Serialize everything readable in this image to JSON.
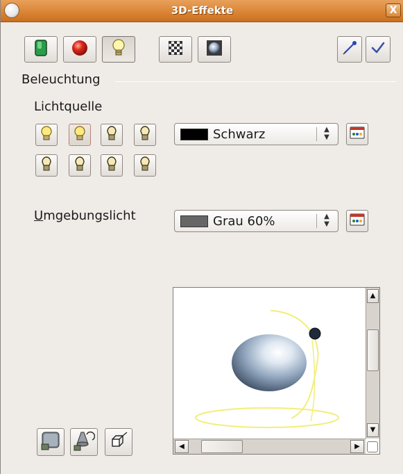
{
  "window": {
    "title": "3D-Effekte",
    "close_glyph": "X"
  },
  "toolbar": {
    "buttons": [
      {
        "name": "geometry",
        "icon": "green-cube-icon",
        "active": false
      },
      {
        "name": "shading",
        "icon": "red-sphere-icon",
        "active": false
      },
      {
        "name": "illumination",
        "icon": "light-bulb-icon",
        "active": true
      },
      {
        "name": "textures",
        "icon": "checkerboard-icon",
        "active": false
      },
      {
        "name": "material",
        "icon": "material-sphere-icon",
        "active": false
      }
    ],
    "right_buttons": [
      {
        "name": "assign",
        "icon": "pipette-icon"
      },
      {
        "name": "update",
        "icon": "checkmark-icon"
      }
    ]
  },
  "illumination": {
    "section_label": "Beleuchtung",
    "light_source_label": "Lichtquelle",
    "light_source_color": {
      "value": "Schwarz",
      "swatch": "#000000"
    },
    "ambient_label_first": "U",
    "ambient_label_rest": "mgebungslicht",
    "ambient_color": {
      "value": "Grau 60%",
      "swatch": "#666666"
    },
    "light_bulbs": [
      {
        "index": 1,
        "state": "on",
        "selected": false
      },
      {
        "index": 2,
        "state": "on",
        "selected": true
      },
      {
        "index": 3,
        "state": "off",
        "selected": false
      },
      {
        "index": 4,
        "state": "off",
        "selected": false
      },
      {
        "index": 5,
        "state": "off",
        "selected": false
      },
      {
        "index": 6,
        "state": "off",
        "selected": false
      },
      {
        "index": 7,
        "state": "off",
        "selected": false
      },
      {
        "index": 8,
        "state": "off",
        "selected": false
      }
    ]
  },
  "bottom_buttons": [
    {
      "name": "convert-to-3d",
      "icon": "convert-3d-icon"
    },
    {
      "name": "convert-to-lathe",
      "icon": "lathe-object-icon"
    },
    {
      "name": "perspective",
      "icon": "perspective-icon"
    }
  ],
  "colors": {
    "titlebar": "#de8a3c",
    "dialog_bg": "#efebe7",
    "light_path": "#f2ee7a"
  }
}
